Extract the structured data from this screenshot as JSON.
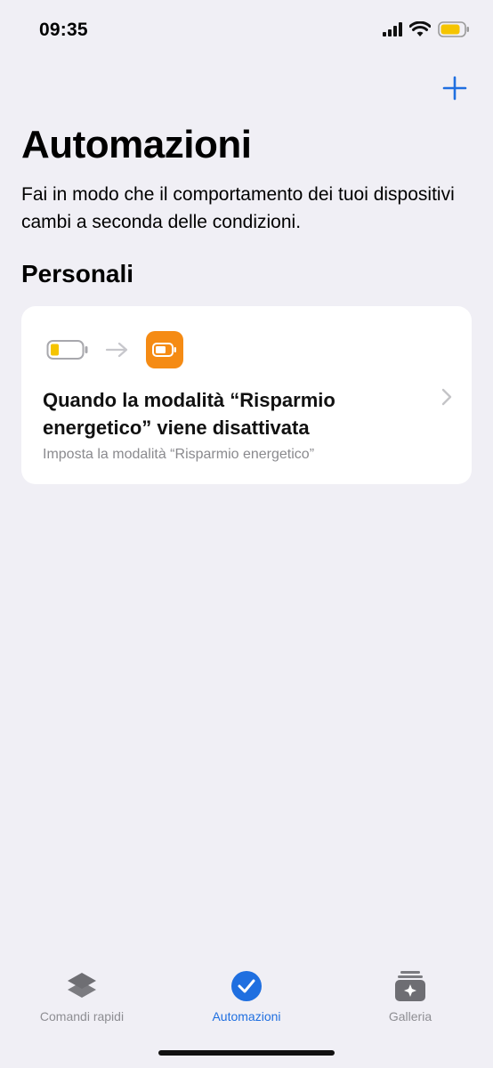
{
  "status_bar": {
    "time": "09:35"
  },
  "header": {
    "title": "Automazioni",
    "subtitle": "Fai in modo che il comportamento dei tuoi dispositivi cambi a seconda delle condizioni."
  },
  "section": {
    "title": "Personali"
  },
  "automation": {
    "title": "Quando la modalità “Risparmio energetico” viene disattivata",
    "action": "Imposta la modalità “Risparmio energetico”"
  },
  "tabs": [
    {
      "label": "Comandi rapidi",
      "icon": "layers-icon",
      "active": false
    },
    {
      "label": "Automazioni",
      "icon": "checkmark-circle-icon",
      "active": true
    },
    {
      "label": "Galleria",
      "icon": "gallery-icon",
      "active": false
    }
  ],
  "colors": {
    "accent": "#1f6fe0",
    "badge": "#f58b14",
    "battery": "#f5b700"
  }
}
